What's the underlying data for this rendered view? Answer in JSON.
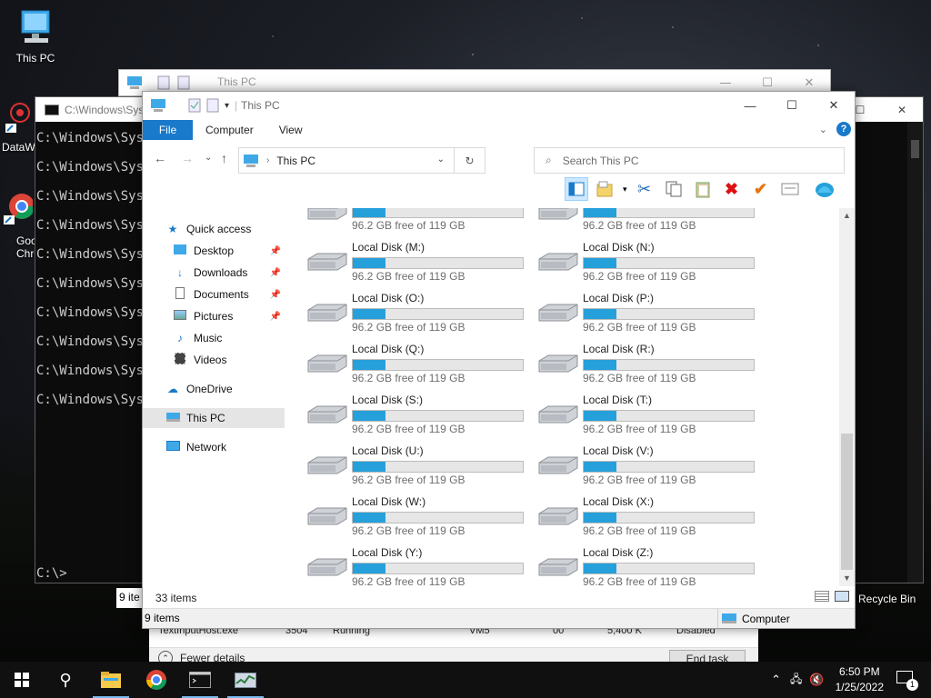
{
  "desktop": {
    "icons": [
      {
        "label": "This PC",
        "icon": "monitor-icon"
      },
      {
        "label": "DataW",
        "icon": "datawave-icon"
      },
      {
        "label": "Goo Chro",
        "icon": "chrome-icon"
      }
    ],
    "recycle_bin_label": "Recycle Bin"
  },
  "cmd": {
    "title": "C:\\Windows\\Sys",
    "lines": [
      "C:\\Windows\\Syst",
      "C:\\Windows\\Syst",
      "C:\\Windows\\Syst",
      "C:\\Windows\\Syst",
      "C:\\Windows\\Syst",
      "C:\\Windows\\Syst",
      "C:\\Windows\\Syst",
      "C:\\Windows\\Syst",
      "C:\\Windows\\Syst",
      "C:\\Windows\\Syst"
    ],
    "prompt": "C:\\>",
    "items_label": "9 ite"
  },
  "back_window": {
    "title": "This PC"
  },
  "task_manager": {
    "row": [
      "TextInputHost.exe",
      "3504",
      "Running",
      "VM5",
      "00",
      "5,400 K",
      "Disabled"
    ],
    "fewer_details": "Fewer details",
    "end_task": "End task"
  },
  "explorer": {
    "title": "This PC",
    "tabs": [
      "File",
      "Computer",
      "View"
    ],
    "address": "This PC",
    "search_placeholder": "Search This PC",
    "nav": {
      "quick_access": "Quick access",
      "desktop": "Desktop",
      "downloads": "Downloads",
      "documents": "Documents",
      "pictures": "Pictures",
      "music": "Music",
      "videos": "Videos",
      "onedrive": "OneDrive",
      "this_pc": "This PC",
      "network": "Network"
    },
    "drives": [
      {
        "name": "",
        "free": "96.2 GB free of 119 GB"
      },
      {
        "name": "",
        "free": "96.2 GB free of 119 GB"
      },
      {
        "name": "Local Disk (M:)",
        "free": "96.2 GB free of 119 GB"
      },
      {
        "name": "Local Disk (N:)",
        "free": "96.2 GB free of 119 GB"
      },
      {
        "name": "Local Disk (O:)",
        "free": "96.2 GB free of 119 GB"
      },
      {
        "name": "Local Disk (P:)",
        "free": "96.2 GB free of 119 GB"
      },
      {
        "name": "Local Disk (Q:)",
        "free": "96.2 GB free of 119 GB"
      },
      {
        "name": "Local Disk (R:)",
        "free": "96.2 GB free of 119 GB"
      },
      {
        "name": "Local Disk (S:)",
        "free": "96.2 GB free of 119 GB"
      },
      {
        "name": "Local Disk (T:)",
        "free": "96.2 GB free of 119 GB"
      },
      {
        "name": "Local Disk (U:)",
        "free": "96.2 GB free of 119 GB"
      },
      {
        "name": "Local Disk (V:)",
        "free": "96.2 GB free of 119 GB"
      },
      {
        "name": "Local Disk (W:)",
        "free": "96.2 GB free of 119 GB"
      },
      {
        "name": "Local Disk (X:)",
        "free": "96.2 GB free of 119 GB"
      },
      {
        "name": "Local Disk (Y:)",
        "free": "96.2 GB free of 119 GB"
      },
      {
        "name": "Local Disk (Z:)",
        "free": "96.2 GB free of 119 GB"
      }
    ],
    "used_fraction": 0.19,
    "status_count": "33 items",
    "detail_count": "9 items",
    "detail_location": "Computer",
    "accent": "#26a0da"
  },
  "taskbar": {
    "time": "6:50 PM",
    "date": "1/25/2022",
    "notification_count": "1"
  }
}
